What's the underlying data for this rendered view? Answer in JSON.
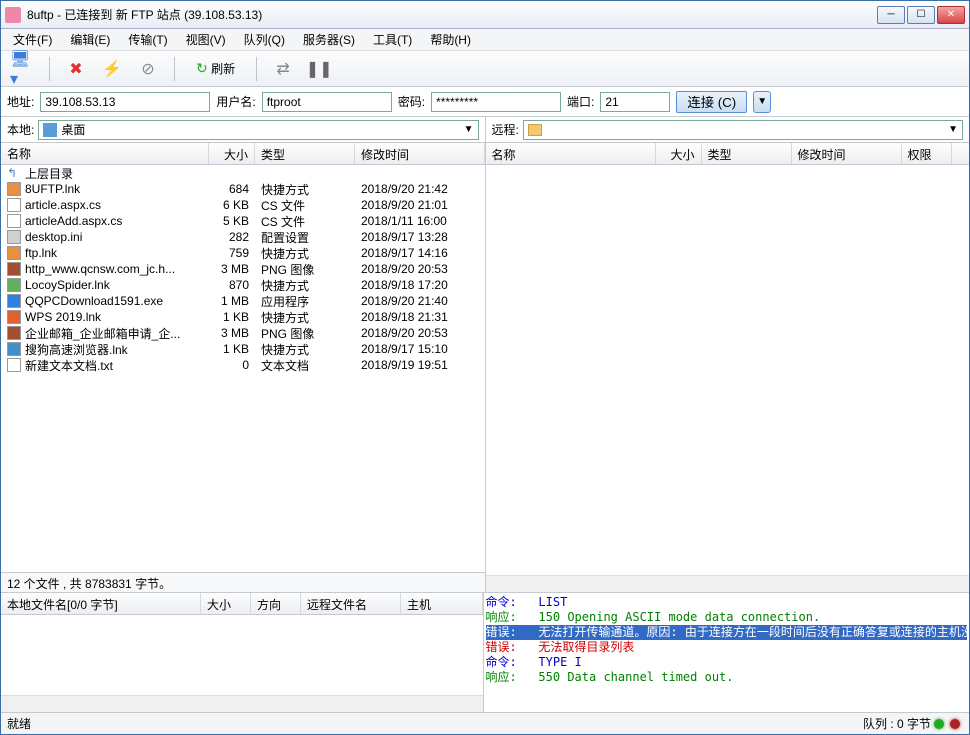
{
  "window": {
    "title": "8uftp - 已连接到 新 FTP 站点 (39.108.53.13)"
  },
  "menu": {
    "file": "文件(F)",
    "edit": "编辑(E)",
    "transfer": "传输(T)",
    "view": "视图(V)",
    "queue": "队列(Q)",
    "server": "服务器(S)",
    "tools": "工具(T)",
    "help": "帮助(H)"
  },
  "toolbar": {
    "refresh": "刷新"
  },
  "conn": {
    "addr_label": "地址:",
    "addr": "39.108.53.13",
    "user_label": "用户名:",
    "user": "ftproot",
    "pass_label": "密码:",
    "pass": "*********",
    "port_label": "端口:",
    "port": "21",
    "connect": "连接 (C)"
  },
  "local": {
    "label": "本地:",
    "path": "桌面",
    "cols": {
      "name": "名称",
      "size": "大小",
      "type": "类型",
      "date": "修改时间"
    },
    "updir": "上层目录",
    "files": [
      {
        "name": "8UFTP.lnk",
        "size": "684",
        "type": "快捷方式",
        "date": "2018/9/20 21:42",
        "icon": "#e89040"
      },
      {
        "name": "article.aspx.cs",
        "size": "6 KB",
        "type": "CS 文件",
        "date": "2018/9/20 21:01",
        "icon": "#ffffff"
      },
      {
        "name": "articleAdd.aspx.cs",
        "size": "5 KB",
        "type": "CS 文件",
        "date": "2018/1/11 16:00",
        "icon": "#ffffff"
      },
      {
        "name": "desktop.ini",
        "size": "282",
        "type": "配置设置",
        "date": "2018/9/17 13:28",
        "icon": "#d0d0d0"
      },
      {
        "name": "ftp.lnk",
        "size": "759",
        "type": "快捷方式",
        "date": "2018/9/17 14:16",
        "icon": "#e89040"
      },
      {
        "name": "http_www.qcnsw.com_jc.h...",
        "size": "3 MB",
        "type": "PNG 图像",
        "date": "2018/9/20 20:53",
        "icon": "#a05030"
      },
      {
        "name": "LocoySpider.lnk",
        "size": "870",
        "type": "快捷方式",
        "date": "2018/9/18 17:20",
        "icon": "#60b060"
      },
      {
        "name": "QQPCDownload1591.exe",
        "size": "1 MB",
        "type": "应用程序",
        "date": "2018/9/20 21:40",
        "icon": "#3080e0"
      },
      {
        "name": "WPS 2019.lnk",
        "size": "1 KB",
        "type": "快捷方式",
        "date": "2018/9/18 21:31",
        "icon": "#e06030"
      },
      {
        "name": "企业邮箱_企业邮箱申请_企...",
        "size": "3 MB",
        "type": "PNG 图像",
        "date": "2018/9/20 20:53",
        "icon": "#a05030"
      },
      {
        "name": "搜狗高速浏览器.lnk",
        "size": "1 KB",
        "type": "快捷方式",
        "date": "2018/9/17 15:10",
        "icon": "#4090d0"
      },
      {
        "name": "新建文本文档.txt",
        "size": "0",
        "type": "文本文档",
        "date": "2018/9/19 19:51",
        "icon": "#ffffff"
      }
    ],
    "status": "12 个文件 , 共 8783831 字节。"
  },
  "remote": {
    "label": "远程:",
    "cols": {
      "name": "名称",
      "size": "大小",
      "type": "类型",
      "date": "修改时间",
      "perm": "权限"
    }
  },
  "queue": {
    "cols": {
      "localname": "本地文件名[0/0 字节]",
      "size": "大小",
      "dir": "方向",
      "remotename": "远程文件名",
      "host": "主机"
    }
  },
  "log": [
    {
      "cls": "cmd",
      "label": "命令:",
      "text": "LIST"
    },
    {
      "cls": "resp",
      "label": "响应:",
      "text": "150 Opening ASCII mode data connection."
    },
    {
      "cls": "err hl",
      "label": "错误:",
      "text": "无法打开传输通道。原因: 由于连接方在一段时间后没有正确答复或连接的主机没有反应，连接尝试失败。"
    },
    {
      "cls": "err",
      "label": "错误:",
      "text": "无法取得目录列表"
    },
    {
      "cls": "cmd",
      "label": "命令:",
      "text": "TYPE I"
    },
    {
      "cls": "resp",
      "label": "响应:",
      "text": "550 Data channel timed out."
    }
  ],
  "status": {
    "ready": "就绪",
    "queue": "队列 : 0 字节"
  }
}
